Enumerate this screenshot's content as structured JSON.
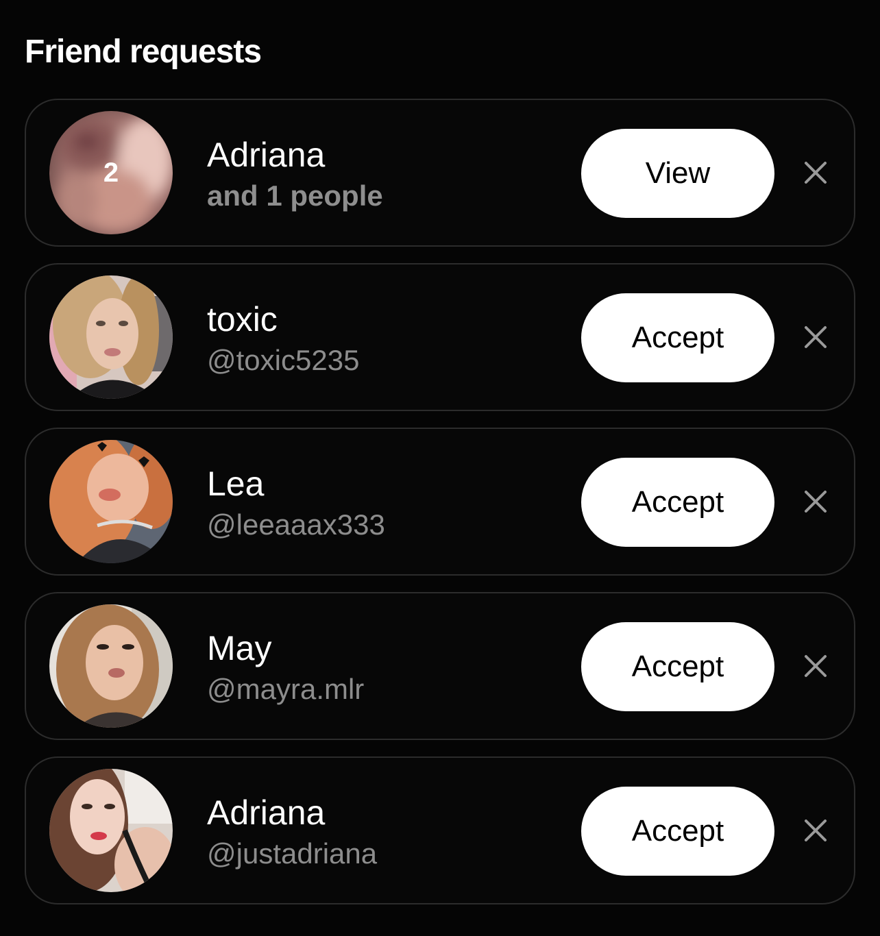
{
  "page": {
    "title": "Friend requests"
  },
  "colors": {
    "background": "#050505",
    "card_border": "#2c2c2c",
    "button_bg": "#ffffff",
    "button_text": "#000000",
    "secondary_text": "#8d8d8d",
    "dismiss_icon": "#9a9a9a"
  },
  "requests": [
    {
      "name": "Adriana",
      "subtitle": "and 1 people",
      "avatar_badge": "2",
      "avatar_icon": "blurred-group-photo",
      "action_label": "View",
      "dismiss_icon": "close-icon"
    },
    {
      "name": "toxic",
      "subtitle": "@toxic5235",
      "avatar_icon": "profile-photo",
      "action_label": "Accept",
      "dismiss_icon": "close-icon"
    },
    {
      "name": "Lea",
      "subtitle": "@leeaaax333",
      "avatar_icon": "profile-photo",
      "action_label": "Accept",
      "dismiss_icon": "close-icon"
    },
    {
      "name": "May",
      "subtitle": "@mayra.mlr",
      "avatar_icon": "profile-photo",
      "action_label": "Accept",
      "dismiss_icon": "close-icon"
    },
    {
      "name": "Adriana",
      "subtitle": "@justadriana",
      "avatar_icon": "profile-photo",
      "action_label": "Accept",
      "dismiss_icon": "close-icon"
    }
  ]
}
